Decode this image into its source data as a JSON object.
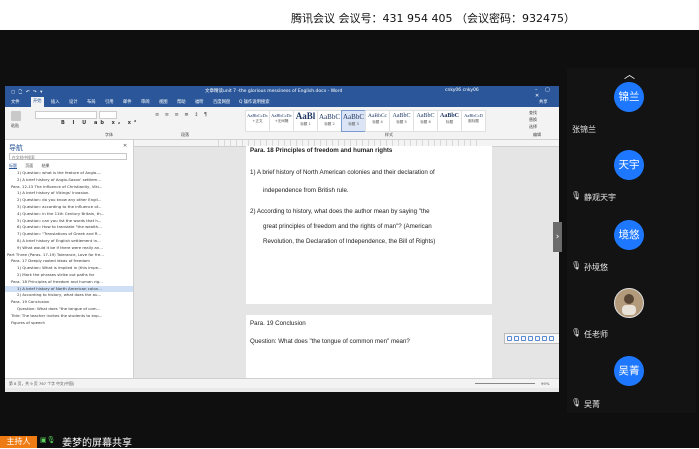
{
  "meeting": {
    "info": "腾讯会议 会议号：431 954 405 （会议密码：932475）"
  },
  "word": {
    "title": "文章精读unit 7 -the glorious messiness of English.docx - Word",
    "user": "cnky06 cnky06",
    "quick_access": "▢ 🗋 ↶ ↷ ▾",
    "menu_tabs": [
      "文件",
      "开始",
      "插入",
      "设计",
      "布局",
      "引用",
      "邮件",
      "审阅",
      "视图",
      "帮助",
      "福昕",
      "百度网盘",
      "Q 操作说明搜索"
    ],
    "share_label": "共享",
    "clipboard_label": "粘贴",
    "font_group_label": "字体",
    "paragraph_group_label": "段落",
    "styles_group_label": "样式",
    "editing_group_label": "编辑",
    "editing_items": [
      "查找",
      "替换",
      "选择"
    ],
    "styles": [
      {
        "sample": "AaBbCcDc",
        "name": "+正文",
        "size": "4.5px"
      },
      {
        "sample": "AaBbCcDc",
        "name": "+无间隔",
        "size": "4.5px"
      },
      {
        "sample": "AaBl",
        "name": "标题 1",
        "size": "9px"
      },
      {
        "sample": "AaBbC",
        "name": "标题 2",
        "size": "7px"
      },
      {
        "sample": "AaBbC",
        "name": "标题 3",
        "size": "7px"
      },
      {
        "sample": "AaBbCc",
        "name": "标题 4",
        "size": "5.5px"
      },
      {
        "sample": "AaBbC",
        "name": "标题 5",
        "size": "6px"
      },
      {
        "sample": "AaBbC",
        "name": "标题 6",
        "size": "6px"
      },
      {
        "sample": "AaBbC",
        "name": "标题",
        "size": "6px"
      },
      {
        "sample": "AaBbCcD",
        "name": "副标题",
        "size": "4.5px"
      }
    ],
    "nav": {
      "title": "导航",
      "search_placeholder": "在文档中搜索",
      "tabs": [
        "标题",
        "页面",
        "结果"
      ],
      "items": [
        "1) Question: what is the feature of Anglo-...",
        "2) A brief history of Anglo-Saxon' settlem...",
        "Para. 12-15 The influence of Christianity, Viki...",
        "1) A brief history of Vikings' Invasion.",
        "2) Question: do you know any other Engli...",
        "3) Question: according to the influence of...",
        "4) Question: in the 11th Century Britain, th...",
        "5) Question: can you list the words that h...",
        "6) Question: How to translate \"the wealth...",
        "7) Question: \"Translations of Greek and R...",
        "8) A brief history of English settlement in...",
        "9) What would it be if there were really an...",
        "Part Three (Paras. 17-19) Tolerance, Love for fre...",
        "Para. 17 Deeply rooted ideas of freedom",
        "1) Question: What is implied in (this impe...",
        "2) Mark the phrases strike out paths for",
        "Para. 18 Principles of freedom and human rig...",
        "1) A brief history of North American colon...",
        "2) According to history, what does the au...",
        "Para. 19 Conclusion",
        "Question: What does \"the tongue of com...",
        "Title: The teacher invites the students to exp...",
        "Figures of speech"
      ]
    },
    "doc": {
      "heading": "Para. 18 Principles of freedom and human rights",
      "item1_line1": "1)  A brief history of North American colonies and their declaration of",
      "item1_line2": "independence from British rule.",
      "item2_line1": "2)  According to history, what does the author mean by saying \"the",
      "item2_line2": "great principles of freedom and the rights of man\"? (American",
      "item2_line3": "Revolution, the Declaration of Independence, the Bill of Rights)",
      "page2_heading": "Para. 19 Conclusion",
      "page2_line": "Question: What does \"the tongue of common men\" mean?"
    },
    "status": "第 8 页，共 9 页   767 个字   中文(中国)",
    "zoom": "99%"
  },
  "participants": [
    {
      "avatar": "锦兰",
      "name": "张锦兰",
      "photo": false,
      "mic": false
    },
    {
      "avatar": "天宇",
      "name": "静观天宇",
      "photo": false,
      "mic": true
    },
    {
      "avatar": "境悠",
      "name": "孙境悠",
      "photo": false,
      "mic": true
    },
    {
      "avatar": "",
      "name": "任老师",
      "photo": true,
      "mic": true
    },
    {
      "avatar": "吴菁",
      "name": "吴菁",
      "photo": false,
      "mic": true
    }
  ],
  "bottom": {
    "host_badge": "主持人",
    "share_label": "姜梦的屏幕共享"
  },
  "colors": {
    "word_blue": "#2b579a",
    "avatar_blue": "#1e78ff",
    "host_orange": "#ef7b15"
  }
}
